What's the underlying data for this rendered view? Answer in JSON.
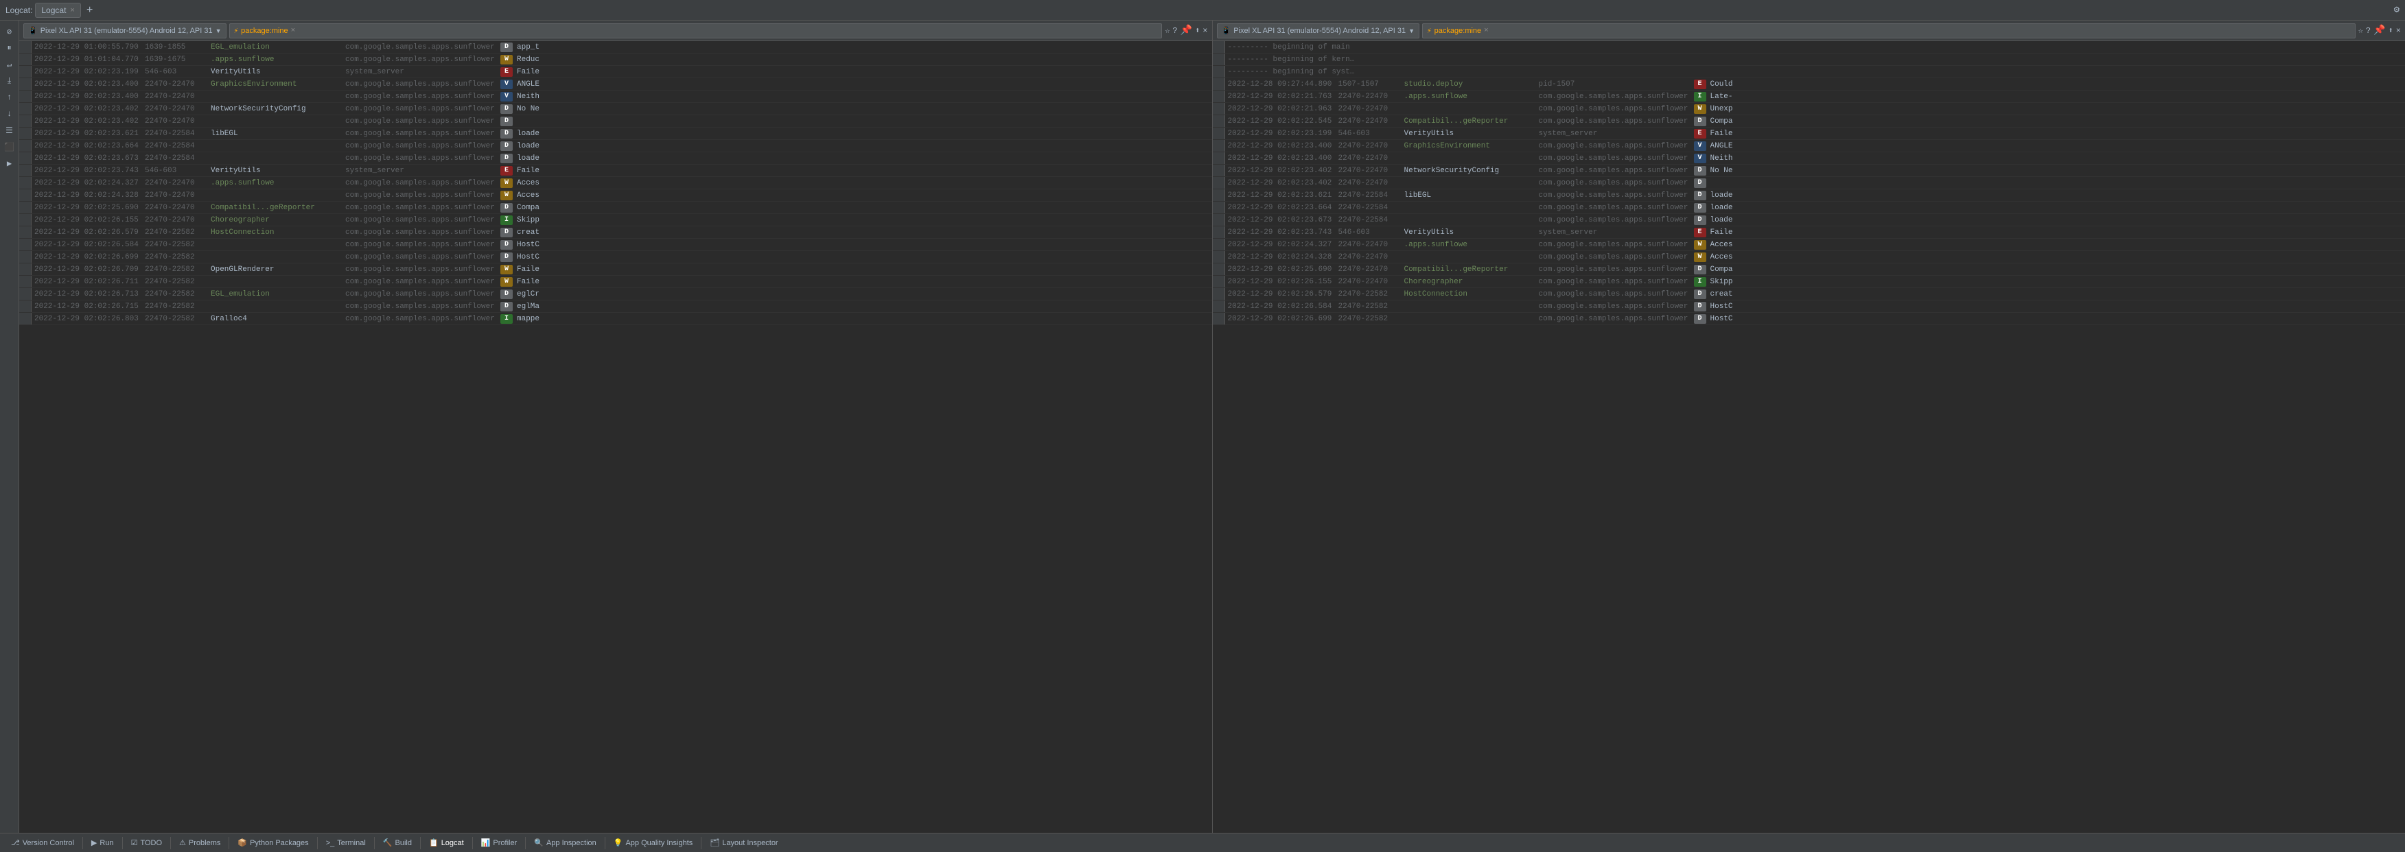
{
  "tabBar": {
    "label": "Logcat:",
    "activeTab": "Logcat",
    "closeChar": "×",
    "addChar": "+",
    "settingsChar": "⚙"
  },
  "leftToolbar": {
    "buttons": [
      {
        "name": "clear",
        "icon": "⊘"
      },
      {
        "name": "pause",
        "icon": "⏸"
      },
      {
        "name": "soft-wrap",
        "icon": "↩"
      },
      {
        "name": "scroll-end",
        "icon": "↓"
      },
      {
        "name": "arrow-up",
        "icon": "↑"
      },
      {
        "name": "arrow-down2",
        "icon": "↓"
      },
      {
        "name": "filter",
        "icon": "☰"
      },
      {
        "name": "camera",
        "icon": "📷"
      },
      {
        "name": "video",
        "icon": "🎥"
      }
    ]
  },
  "panels": [
    {
      "id": "left",
      "device": "Pixel XL API 31 (emulator-5554)  Android 12, API 31",
      "filter": "package:mine",
      "rows": [
        {
          "ts": "2022-12-29 01:00:55.790",
          "pid": "1639-1855",
          "tag": "EGL_emulation",
          "pkg": "com.google.samples.apps.sunflower",
          "level": "D",
          "msg": "app_t",
          "tagColor": "tag-green"
        },
        {
          "ts": "2022-12-29 01:01:04.770",
          "pid": "1639-1675",
          "tag": ".apps.sunflowe",
          "pkg": "com.google.samples.apps.sunflower",
          "level": "W",
          "msg": "Reduc",
          "tagColor": "tag-green"
        },
        {
          "ts": "2022-12-29 02:02:23.199",
          "pid": "546-603",
          "tag": "VerityUtils",
          "pkg": "system_server",
          "level": "E",
          "msg": "Faile",
          "tagColor": ""
        },
        {
          "ts": "2022-12-29 02:02:23.400",
          "pid": "22470-22470",
          "tag": "GraphicsEnvironment",
          "pkg": "com.google.samples.apps.sunflower",
          "level": "V",
          "msg": "ANGLE",
          "tagColor": "tag-green"
        },
        {
          "ts": "2022-12-29 02:02:23.400",
          "pid": "22470-22470",
          "tag": "",
          "pkg": "com.google.samples.apps.sunflower",
          "level": "V",
          "msg": "Neith",
          "tagColor": ""
        },
        {
          "ts": "2022-12-29 02:02:23.402",
          "pid": "22470-22470",
          "tag": "NetworkSecurityConfig",
          "pkg": "com.google.samples.apps.sunflower",
          "level": "D",
          "msg": "No Ne",
          "tagColor": ""
        },
        {
          "ts": "2022-12-29 02:02:23.402",
          "pid": "22470-22470",
          "tag": "",
          "pkg": "com.google.samples.apps.sunflower",
          "level": "D",
          "msg": "",
          "tagColor": ""
        },
        {
          "ts": "2022-12-29 02:02:23.621",
          "pid": "22470-22584",
          "tag": "libEGL",
          "pkg": "com.google.samples.apps.sunflower",
          "level": "D",
          "msg": "loade",
          "tagColor": ""
        },
        {
          "ts": "2022-12-29 02:02:23.664",
          "pid": "22470-22584",
          "tag": "",
          "pkg": "com.google.samples.apps.sunflower",
          "level": "D",
          "msg": "loade",
          "tagColor": ""
        },
        {
          "ts": "2022-12-29 02:02:23.673",
          "pid": "22470-22584",
          "tag": "",
          "pkg": "com.google.samples.apps.sunflower",
          "level": "D",
          "msg": "loade",
          "tagColor": ""
        },
        {
          "ts": "2022-12-29 02:02:23.743",
          "pid": "546-603",
          "tag": "VerityUtils",
          "pkg": "system_server",
          "level": "E",
          "msg": "Faile",
          "tagColor": ""
        },
        {
          "ts": "2022-12-29 02:02:24.327",
          "pid": "22470-22470",
          "tag": ".apps.sunflowe",
          "pkg": "com.google.samples.apps.sunflower",
          "level": "W",
          "msg": "Acces",
          "tagColor": "tag-green"
        },
        {
          "ts": "2022-12-29 02:02:24.328",
          "pid": "22470-22470",
          "tag": "",
          "pkg": "com.google.samples.apps.sunflower",
          "level": "W",
          "msg": "Acces",
          "tagColor": ""
        },
        {
          "ts": "2022-12-29 02:02:25.690",
          "pid": "22470-22470",
          "tag": "Compatibil...geReporter",
          "pkg": "com.google.samples.apps.sunflower",
          "level": "D",
          "msg": "Compa",
          "tagColor": "tag-green"
        },
        {
          "ts": "2022-12-29 02:02:26.155",
          "pid": "22470-22470",
          "tag": "Choreographer",
          "pkg": "com.google.samples.apps.sunflower",
          "level": "I",
          "msg": "Skipp",
          "tagColor": "tag-green"
        },
        {
          "ts": "2022-12-29 02:02:26.579",
          "pid": "22470-22582",
          "tag": "HostConnection",
          "pkg": "com.google.samples.apps.sunflower",
          "level": "D",
          "msg": "creat",
          "tagColor": "tag-green"
        },
        {
          "ts": "2022-12-29 02:02:26.584",
          "pid": "22470-22582",
          "tag": "",
          "pkg": "com.google.samples.apps.sunflower",
          "level": "D",
          "msg": "HostC",
          "tagColor": ""
        },
        {
          "ts": "2022-12-29 02:02:26.699",
          "pid": "22470-22582",
          "tag": "",
          "pkg": "com.google.samples.apps.sunflower",
          "level": "D",
          "msg": "HostC",
          "tagColor": ""
        },
        {
          "ts": "2022-12-29 02:02:26.709",
          "pid": "22470-22582",
          "tag": "OpenGLRenderer",
          "pkg": "com.google.samples.apps.sunflower",
          "level": "W",
          "msg": "Faile",
          "tagColor": ""
        },
        {
          "ts": "2022-12-29 02:02:26.711",
          "pid": "22470-22582",
          "tag": "",
          "pkg": "com.google.samples.apps.sunflower",
          "level": "W",
          "msg": "Faile",
          "tagColor": ""
        },
        {
          "ts": "2022-12-29 02:02:26.713",
          "pid": "22470-22582",
          "tag": "EGL_emulation",
          "pkg": "com.google.samples.apps.sunflower",
          "level": "D",
          "msg": "eglCr",
          "tagColor": "tag-green"
        },
        {
          "ts": "2022-12-29 02:02:26.715",
          "pid": "22470-22582",
          "tag": "",
          "pkg": "com.google.samples.apps.sunflower",
          "level": "D",
          "msg": "eglMa",
          "tagColor": ""
        },
        {
          "ts": "2022-12-29 02:02:26.803",
          "pid": "22470-22582",
          "tag": "Gralloc4",
          "pkg": "com.google.samples.apps.sunflower",
          "level": "I",
          "msg": "mappe",
          "tagColor": ""
        }
      ]
    },
    {
      "id": "right",
      "device": "Pixel XL API 31 (emulator-5554)  Android 12, API 31",
      "filter": "package:mine",
      "rows": [
        {
          "ts": "",
          "pid": "",
          "tag": "--------- beginning of main",
          "pkg": "",
          "level": "",
          "msg": "",
          "tagColor": "tag-dashes"
        },
        {
          "ts": "",
          "pid": "",
          "tag": "--------- beginning of kernel",
          "pkg": "",
          "level": "",
          "msg": "",
          "tagColor": "tag-dashes"
        },
        {
          "ts": "",
          "pid": "",
          "tag": "--------- beginning of system",
          "pkg": "",
          "level": "",
          "msg": "",
          "tagColor": "tag-dashes"
        },
        {
          "ts": "2022-12-28 09:27:44.890",
          "pid": "1507-1507",
          "tag": "studio.deploy",
          "pkg": "pid-1507",
          "level": "E",
          "msg": "Could",
          "tagColor": "tag-green"
        },
        {
          "ts": "2022-12-29 02:02:21.763",
          "pid": "22470-22470",
          "tag": ".apps.sunflowe",
          "pkg": "com.google.samples.apps.sunflower",
          "level": "I",
          "msg": "Late-",
          "tagColor": "tag-green"
        },
        {
          "ts": "2022-12-29 02:02:21.963",
          "pid": "22470-22470",
          "tag": "",
          "pkg": "com.google.samples.apps.sunflower",
          "level": "W",
          "msg": "Unexp",
          "tagColor": ""
        },
        {
          "ts": "2022-12-29 02:02:22.545",
          "pid": "22470-22470",
          "tag": "Compatibil...geReporter",
          "pkg": "com.google.samples.apps.sunflower",
          "level": "D",
          "msg": "Compa",
          "tagColor": "tag-green"
        },
        {
          "ts": "2022-12-29 02:02:23.199",
          "pid": "546-603",
          "tag": "VerityUtils",
          "pkg": "system_server",
          "level": "E",
          "msg": "Faile",
          "tagColor": ""
        },
        {
          "ts": "2022-12-29 02:02:23.400",
          "pid": "22470-22470",
          "tag": "GraphicsEnvironment",
          "pkg": "com.google.samples.apps.sunflower",
          "level": "V",
          "msg": "ANGLE",
          "tagColor": "tag-green"
        },
        {
          "ts": "2022-12-29 02:02:23.400",
          "pid": "22470-22470",
          "tag": "",
          "pkg": "com.google.samples.apps.sunflower",
          "level": "V",
          "msg": "Neith",
          "tagColor": ""
        },
        {
          "ts": "2022-12-29 02:02:23.402",
          "pid": "22470-22470",
          "tag": "NetworkSecurityConfig",
          "pkg": "com.google.samples.apps.sunflower",
          "level": "D",
          "msg": "No Ne",
          "tagColor": ""
        },
        {
          "ts": "2022-12-29 02:02:23.402",
          "pid": "22470-22470",
          "tag": "",
          "pkg": "com.google.samples.apps.sunflower",
          "level": "D",
          "msg": "",
          "tagColor": ""
        },
        {
          "ts": "2022-12-29 02:02:23.621",
          "pid": "22470-22584",
          "tag": "libEGL",
          "pkg": "com.google.samples.apps.sunflower",
          "level": "D",
          "msg": "loade",
          "tagColor": ""
        },
        {
          "ts": "2022-12-29 02:02:23.664",
          "pid": "22470-22584",
          "tag": "",
          "pkg": "com.google.samples.apps.sunflower",
          "level": "D",
          "msg": "loade",
          "tagColor": ""
        },
        {
          "ts": "2022-12-29 02:02:23.673",
          "pid": "22470-22584",
          "tag": "",
          "pkg": "com.google.samples.apps.sunflower",
          "level": "D",
          "msg": "loade",
          "tagColor": ""
        },
        {
          "ts": "2022-12-29 02:02:23.743",
          "pid": "546-603",
          "tag": "VerityUtils",
          "pkg": "system_server",
          "level": "E",
          "msg": "Faile",
          "tagColor": ""
        },
        {
          "ts": "2022-12-29 02:02:24.327",
          "pid": "22470-22470",
          "tag": ".apps.sunflowe",
          "pkg": "com.google.samples.apps.sunflower",
          "level": "W",
          "msg": "Acces",
          "tagColor": "tag-green"
        },
        {
          "ts": "2022-12-29 02:02:24.328",
          "pid": "22470-22470",
          "tag": "",
          "pkg": "com.google.samples.apps.sunflower",
          "level": "W",
          "msg": "Acces",
          "tagColor": ""
        },
        {
          "ts": "2022-12-29 02:02:25.690",
          "pid": "22470-22470",
          "tag": "Compatibil...geReporter",
          "pkg": "com.google.samples.apps.sunflower",
          "level": "D",
          "msg": "Compa",
          "tagColor": "tag-green"
        },
        {
          "ts": "2022-12-29 02:02:26.155",
          "pid": "22470-22470",
          "tag": "Choreographer",
          "pkg": "com.google.samples.apps.sunflower",
          "level": "I",
          "msg": "Skipp",
          "tagColor": "tag-green"
        },
        {
          "ts": "2022-12-29 02:02:26.579",
          "pid": "22470-22582",
          "tag": "HostConnection",
          "pkg": "com.google.samples.apps.sunflower",
          "level": "D",
          "msg": "creat",
          "tagColor": "tag-green"
        },
        {
          "ts": "2022-12-29 02:02:26.584",
          "pid": "22470-22582",
          "tag": "",
          "pkg": "com.google.samples.apps.sunflower",
          "level": "D",
          "msg": "HostC",
          "tagColor": ""
        },
        {
          "ts": "2022-12-29 02:02:26.699",
          "pid": "22470-22582",
          "tag": "",
          "pkg": "com.google.samples.apps.sunflower",
          "level": "D",
          "msg": "HostC",
          "tagColor": ""
        }
      ]
    }
  ],
  "bottomBar": {
    "buttons": [
      {
        "name": "version-control",
        "icon": "⎇",
        "label": "Version Control"
      },
      {
        "name": "run",
        "icon": "▶",
        "label": "Run"
      },
      {
        "name": "todo",
        "icon": "☑",
        "label": "TODO"
      },
      {
        "name": "problems",
        "icon": "⚠",
        "label": "Problems"
      },
      {
        "name": "python-packages",
        "icon": "📦",
        "label": "Python Packages"
      },
      {
        "name": "terminal",
        "icon": ">_",
        "label": "Terminal"
      },
      {
        "name": "build",
        "icon": "🔨",
        "label": "Build"
      },
      {
        "name": "logcat",
        "icon": "📋",
        "label": "Logcat"
      },
      {
        "name": "profiler",
        "icon": "📊",
        "label": "Profiler"
      },
      {
        "name": "app-inspection",
        "icon": "🔍",
        "label": "App Inspection"
      },
      {
        "name": "app-quality-insights",
        "icon": "💡",
        "label": "App Quality Insights"
      },
      {
        "name": "layout-inspector",
        "icon": "🗂",
        "label": "Layout Inspector"
      }
    ]
  }
}
